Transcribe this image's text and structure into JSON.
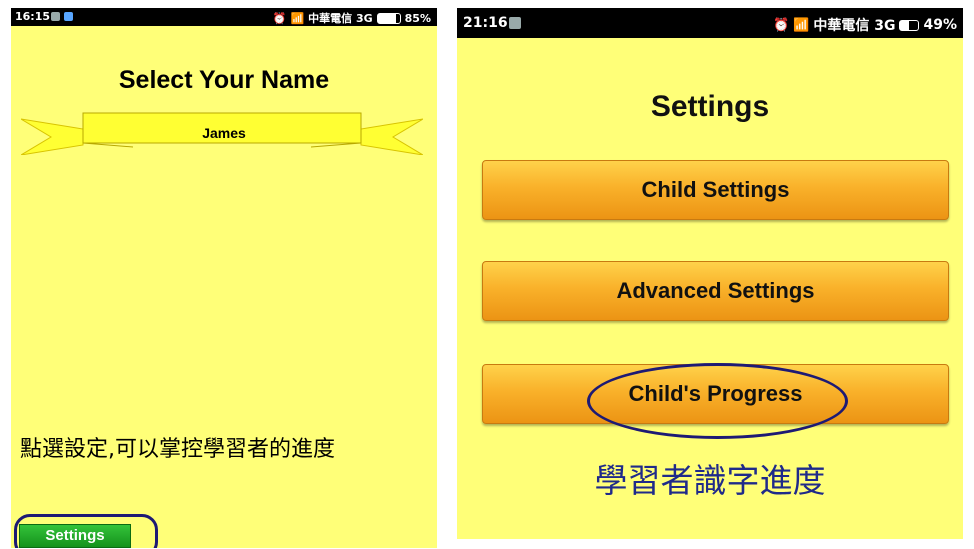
{
  "left_screen": {
    "status_bar": {
      "time": "16:15",
      "right_text": "中華電信 3G",
      "battery": "85%",
      "battery_level": 0.85
    },
    "title": "Select Your Name",
    "name_option": "James",
    "hint": "點選設定,可以掌控學習者的進度",
    "settings_button": "Settings"
  },
  "right_screen": {
    "status_bar": {
      "time": "21:16",
      "right_text": "中華電信 3G",
      "battery": "49%",
      "battery_level": 0.49
    },
    "title": "Settings",
    "buttons": [
      {
        "label": "Child Settings"
      },
      {
        "label": "Advanced Settings"
      },
      {
        "label": "Child's Progress"
      }
    ],
    "hint": "學習者識字進度"
  },
  "colors": {
    "screen_background": "#ffff78",
    "ribbon": "#ffff33",
    "settings_button": "#1fa828",
    "orange_button": "#f9b12a",
    "highlight_circle": "#1e1a74",
    "hint_text_right": "#1f2a8a"
  }
}
